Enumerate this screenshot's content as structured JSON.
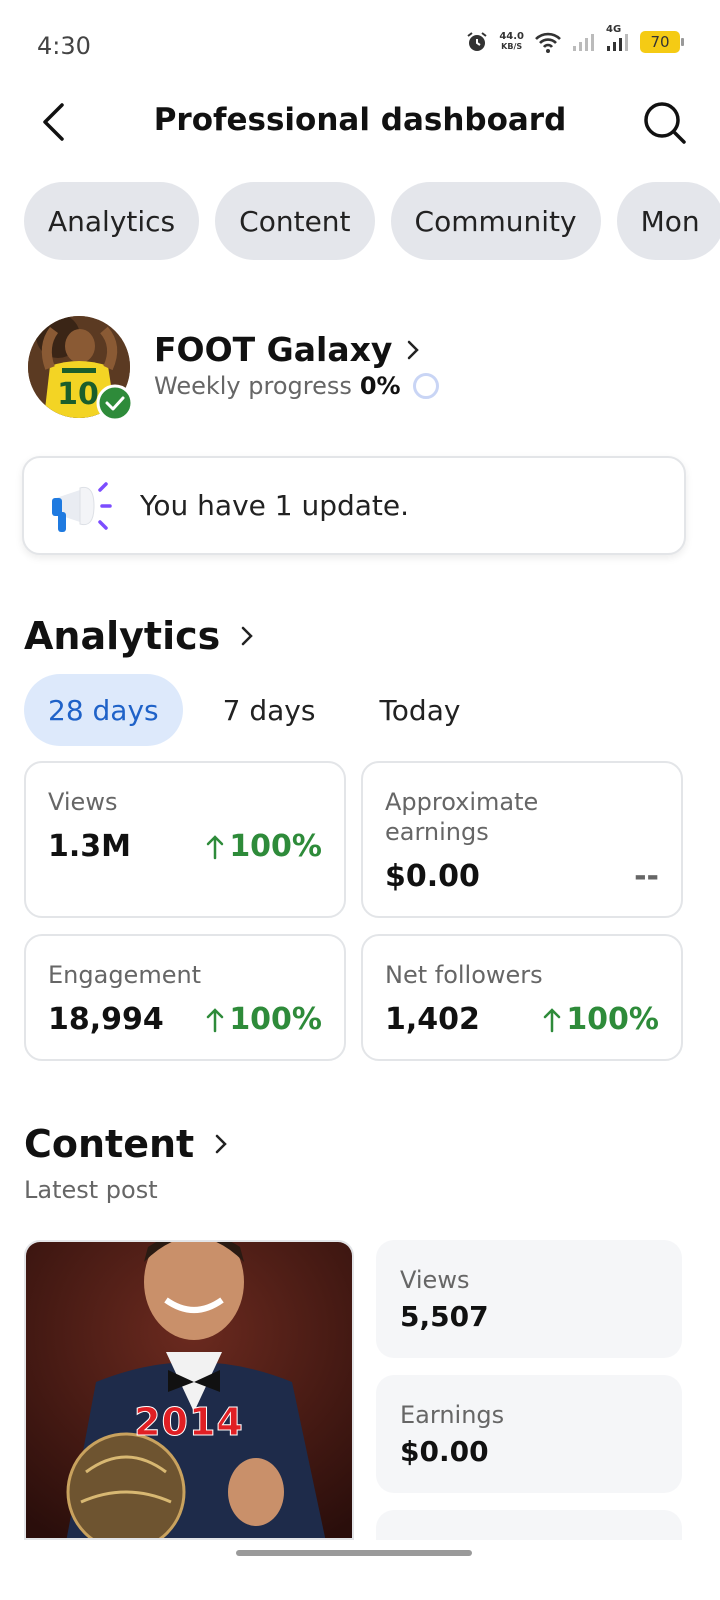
{
  "status_bar": {
    "time": "4:30",
    "net_speed_value": "44.0",
    "net_speed_unit": "KB/S",
    "network_type": "4G",
    "battery": "70"
  },
  "header": {
    "title": "Professional dashboard",
    "back_icon": "chevron-left-icon",
    "search_icon": "search-icon"
  },
  "tabs": [
    {
      "label": "Analytics"
    },
    {
      "label": "Content"
    },
    {
      "label": "Community"
    },
    {
      "label": "Mon"
    }
  ],
  "profile": {
    "name": "FOOT Galaxy",
    "progress_label": "Weekly progress",
    "progress_value": "0%",
    "progress_fraction": 0
  },
  "update_banner": {
    "icon": "megaphone-icon",
    "text": "You have 1 update."
  },
  "analytics": {
    "title": "Analytics",
    "ranges": [
      "28 days",
      "7 days",
      "Today"
    ],
    "selected_range": "28 days",
    "metrics": [
      {
        "label": "Views",
        "value": "1.3M",
        "change": "100%",
        "trend": "up"
      },
      {
        "label": "Approximate earnings",
        "value": "$0.00",
        "change": "--",
        "trend": "none"
      },
      {
        "label": "Engagement",
        "value": "18,994",
        "change": "100%",
        "trend": "up"
      },
      {
        "label": "Net followers",
        "value": "1,402",
        "change": "100%",
        "trend": "up"
      }
    ]
  },
  "content": {
    "title": "Content",
    "subtitle": "Latest post",
    "post_overlay_text": "2014",
    "stats": [
      {
        "label": "Views",
        "value": "5,507"
      },
      {
        "label": "Earnings",
        "value": "$0.00"
      }
    ]
  },
  "colors": {
    "accent": "#1f62c8",
    "positive": "#2e8b3a",
    "chip_bg": "#e4e6eb",
    "active_chip_bg": "#dde9fb"
  }
}
